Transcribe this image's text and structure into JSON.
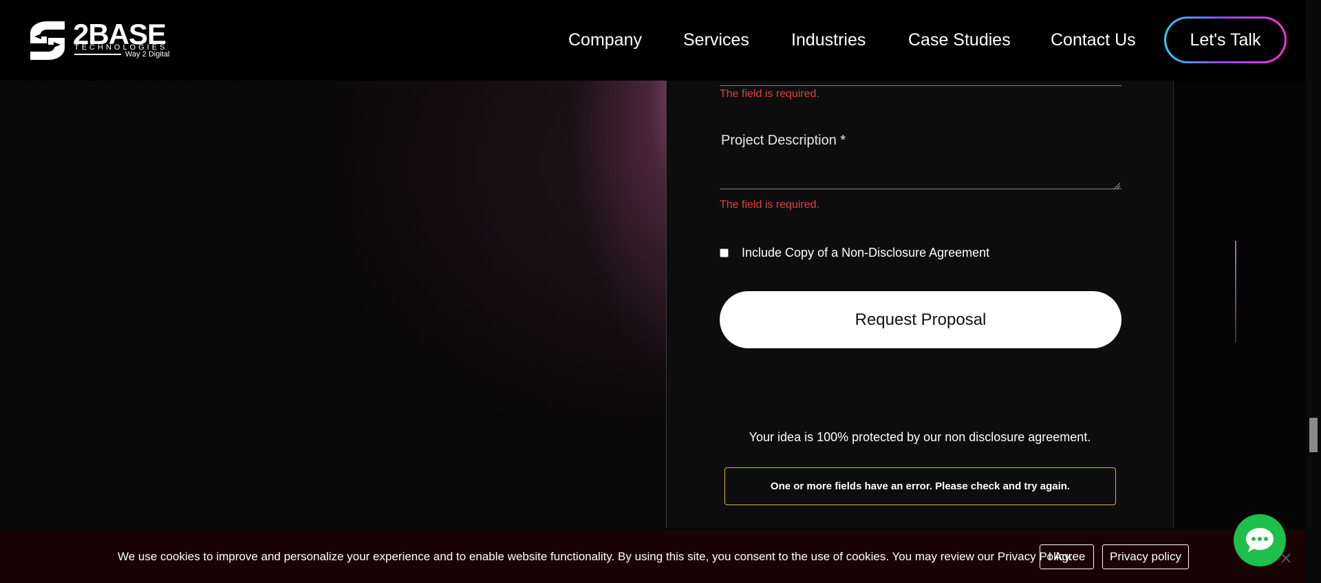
{
  "header": {
    "logo": {
      "main": "2BASE",
      "sub": "TECHNOLOGIES",
      "tagline": "Way 2 Digital"
    },
    "nav": [
      {
        "label": "Company"
      },
      {
        "label": "Services"
      },
      {
        "label": "Industries"
      },
      {
        "label": "Case Studies"
      },
      {
        "label": "Contact Us"
      }
    ],
    "cta_label": "Let's Talk"
  },
  "form": {
    "error_1": "The field is required.",
    "project_description_label": "Project Description *",
    "project_description_value": "",
    "error_2": "The field is required.",
    "nda_label": "Include Copy of a Non-Disclosure Agreement",
    "nda_checked": false,
    "submit_label": "Request Proposal",
    "protection_note": "Your idea is 100% protected by our non disclosure agreement.",
    "validation_message": "One or more fields have an error. Please check and try again."
  },
  "cookie": {
    "text": "We use cookies to improve and personalize your experience and to enable website functionality. By using this site, you consent to the use of cookies. You may review our Privacy Policy.",
    "agree_label": "I Agree",
    "privacy_label": "Privacy policy"
  },
  "colors": {
    "error": "#e0413f",
    "alert_border": "#d7b94a",
    "chat": "#1fbf4b",
    "cta_gradient_start": "#2ad1ff",
    "cta_gradient_end": "#ff2fd6"
  },
  "icons": {
    "logo_mark": "logo-icon",
    "chat": "chat-icon",
    "cookie_close": "close-icon",
    "resize": "resize-grip-icon"
  }
}
